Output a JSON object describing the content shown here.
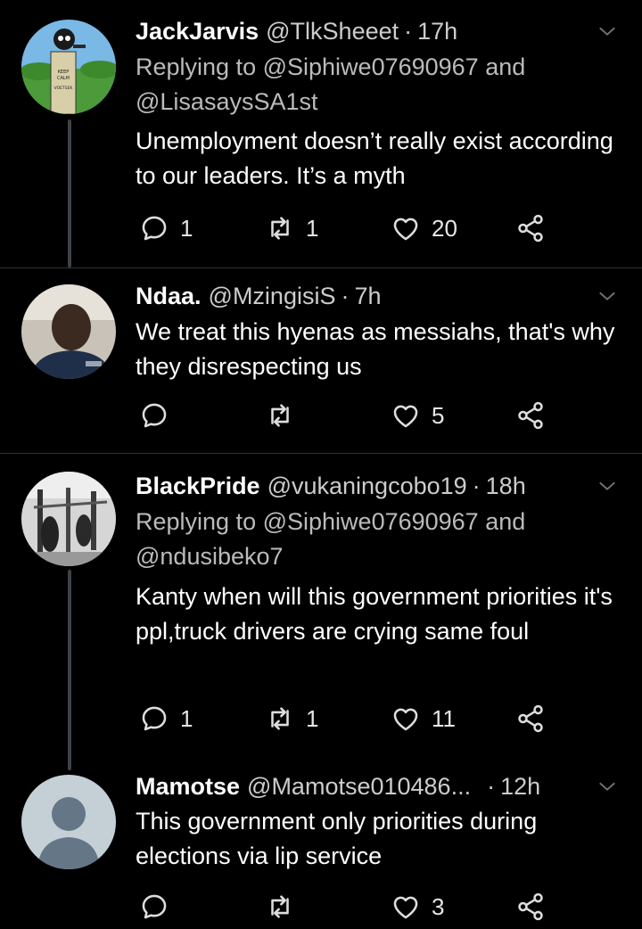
{
  "tweets": [
    {
      "name": "JackJarvis",
      "handle": "@TlkSheeet",
      "time": "17h",
      "replying_prefix": "Replying to",
      "replying_line1": "@Siphiwe07690967 and",
      "replying_line2": "@LisasaysSA1st",
      "text": "Unemployment doesn’t really exist according to our leaders. It’s a myth",
      "replies": "1",
      "retweets": "1",
      "likes": "20"
    },
    {
      "name": "Ndaa.",
      "handle": "@MzingisiS",
      "time": "7h",
      "text": "We treat this hyenas as messiahs, that's why they disrespecting us",
      "replies": "",
      "retweets": "",
      "likes": "5"
    },
    {
      "name": "BlackPride",
      "handle": "@vukaningcobo19",
      "time": "18h",
      "replying_prefix": "Replying to",
      "replying_line1": "@Siphiwe07690967 and",
      "replying_line2": "@ndusibeko7",
      "text": "Kanty when will this government priorities it's ppl,truck drivers are crying same foul",
      "replies": "1",
      "retweets": "1",
      "likes": "11"
    },
    {
      "name": "Mamotse",
      "handle": "@Mamotse010486...",
      "time": "12h",
      "text": "This government only priorities during elections via lip service",
      "replies": "",
      "retweets": "",
      "likes": "3"
    }
  ],
  "avatar_text": {
    "keep": "KEEP",
    "calm": "CALM",
    "voetsek": "VOETSEK"
  },
  "colors": {
    "background": "#000000",
    "text": "#ffffff",
    "secondary": "#bbbbbb",
    "divider": "#2f3336"
  }
}
